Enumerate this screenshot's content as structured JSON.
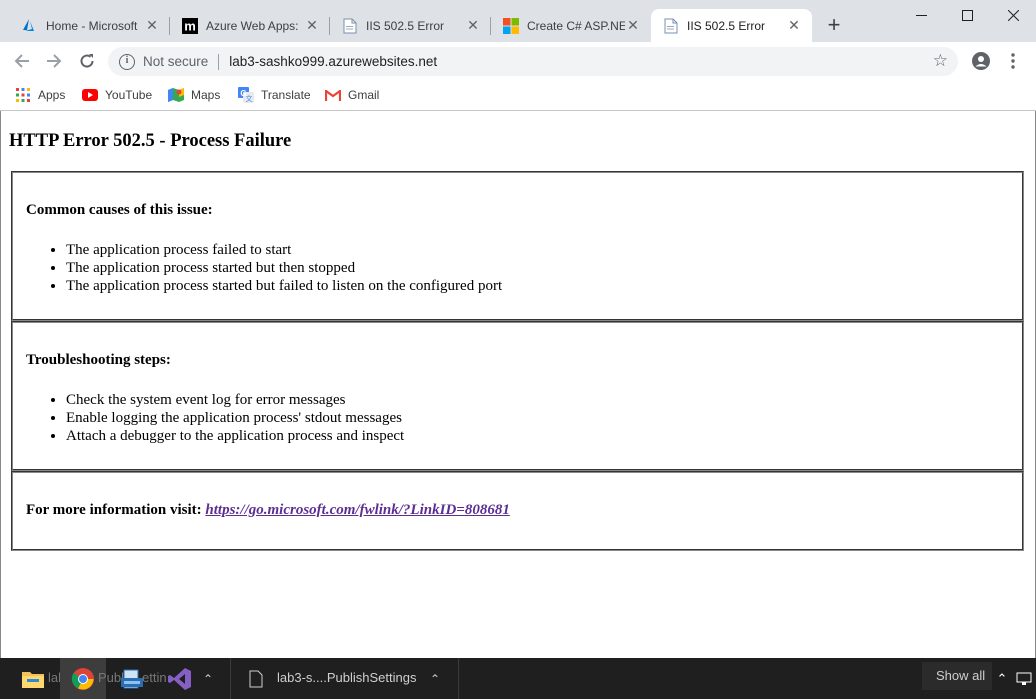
{
  "tabs": [
    {
      "title": "Home - Microsoft",
      "icon": "azure-icon",
      "active": false
    },
    {
      "title": "Azure Web Apps:",
      "icon": "m-icon",
      "active": false
    },
    {
      "title": "IIS 502.5 Error",
      "icon": "page-icon",
      "active": false
    },
    {
      "title": "Create C# ASP.NE",
      "icon": "microsoft-icon",
      "active": false
    },
    {
      "title": "IIS 502.5 Error",
      "icon": "page-icon",
      "active": true
    }
  ],
  "close_glyph": "✕",
  "new_tab_glyph": "+",
  "omnibox": {
    "security": "Not secure",
    "url": "lab3-sashko999.azurewebsites.net"
  },
  "bookmarks": [
    {
      "label": "Apps",
      "icon": "apps-grid-icon"
    },
    {
      "label": "YouTube",
      "icon": "youtube-icon"
    },
    {
      "label": "Maps",
      "icon": "maps-icon"
    },
    {
      "label": "Translate",
      "icon": "translate-icon"
    },
    {
      "label": "Gmail",
      "icon": "gmail-icon"
    }
  ],
  "page": {
    "title": "HTTP Error 502.5 - Process Failure",
    "sections": [
      {
        "heading": "Common causes of this issue:",
        "items": [
          "The application process failed to start",
          "The application process started but then stopped",
          "The application process started but failed to listen on the configured port"
        ]
      },
      {
        "heading": "Troubleshooting steps:",
        "items": [
          "Check the system event log for error messages",
          "Enable logging the application process' stdout messages",
          "Attach a debugger to the application process and inspect"
        ]
      }
    ],
    "more_info_label": "For more information visit:",
    "more_info_link": "https://go.microsoft.com/fwlink/?LinkID=808681"
  },
  "taskbar": {
    "download_label": "lab3-s....PublishSettings",
    "show_all": "Show all",
    "hidden_label_1": "lab3",
    "hidden_label_2": "Publ",
    "hidden_label_3": "ettin"
  },
  "colors": {
    "link": "#5c2e91",
    "tabstrip": "#dee1e6",
    "taskbar": "#1f1f1f"
  }
}
